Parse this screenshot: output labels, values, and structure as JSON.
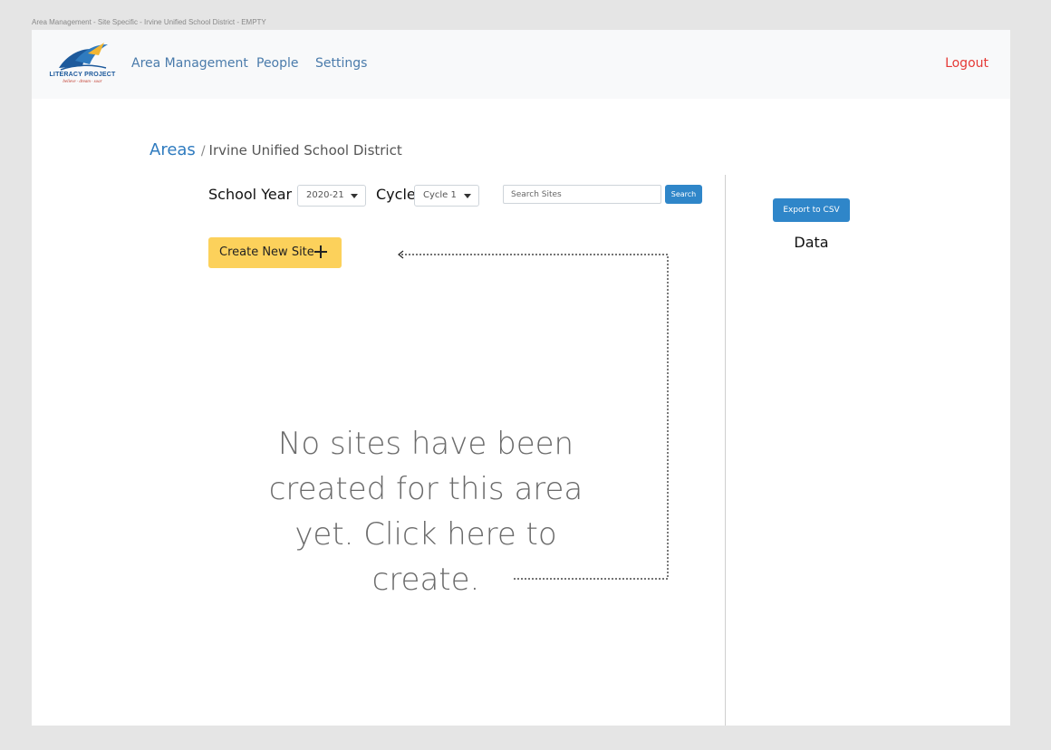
{
  "window_title": "Area Management - Site Specific - Irvine Unified School District - EMPTY",
  "logo": {
    "name": "LITERACY PROJECT",
    "tagline": "believe · dream · soar"
  },
  "nav": {
    "items": [
      {
        "label": "Area Management"
      },
      {
        "label": "People"
      },
      {
        "label": "Settings"
      }
    ],
    "logout": "Logout"
  },
  "breadcrumb": {
    "root": "Areas",
    "separator": "/",
    "current": "Irvine Unified School District"
  },
  "filters": {
    "school_year_label": "School Year",
    "school_year_value": "2020-21",
    "cycle_label": "Cycle",
    "cycle_value": "Cycle 1"
  },
  "search": {
    "placeholder": "Search Sites",
    "value": "",
    "button": "Search"
  },
  "create_button": "Create New Site",
  "empty_message": "No sites have been created for this area yet. Click here to create.",
  "sidebar": {
    "export_button": "Export to CSV",
    "data_label": "Data"
  },
  "colors": {
    "nav_link": "#4a7bab",
    "logout": "#e53935",
    "primary_button": "#2f86c9",
    "create_button": "#fcd15b",
    "breadcrumb_link": "#2f7bbf"
  },
  "icons": {
    "create": "plus-icon",
    "dropdown": "caret-down-icon",
    "hint": "dotted-arrow-icon"
  }
}
